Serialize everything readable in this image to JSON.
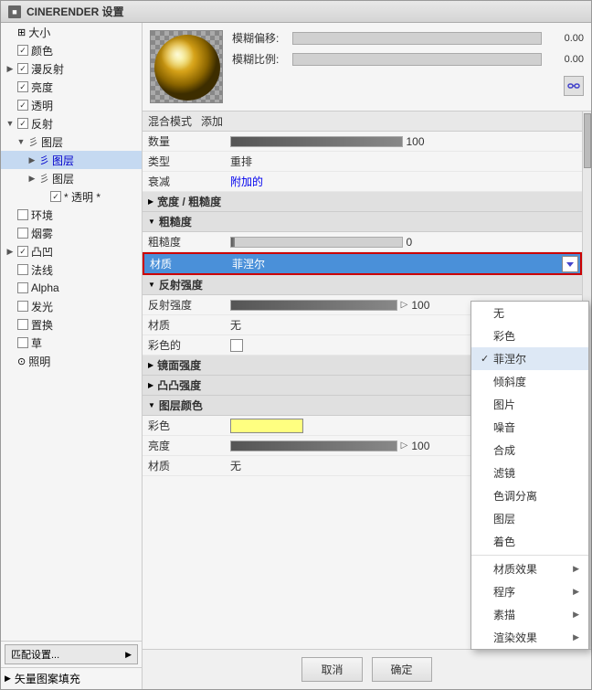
{
  "window": {
    "title": "CINERENDER 设置"
  },
  "sidebar": {
    "items": [
      {
        "id": "size",
        "label": "大小",
        "indent": 0,
        "hasCheckbox": false,
        "hasExpand": false,
        "iconType": "size"
      },
      {
        "id": "color",
        "label": "颜色",
        "indent": 0,
        "hasCheckbox": true,
        "checked": true,
        "hasExpand": false
      },
      {
        "id": "diffuse",
        "label": "漫反射",
        "indent": 0,
        "hasCheckbox": true,
        "checked": true,
        "hasExpand": true,
        "expanded": false
      },
      {
        "id": "brightness",
        "label": "亮度",
        "indent": 0,
        "hasCheckbox": true,
        "checked": true,
        "hasExpand": false
      },
      {
        "id": "transparency",
        "label": "透明",
        "indent": 0,
        "hasCheckbox": true,
        "checked": true,
        "hasExpand": false
      },
      {
        "id": "reflection",
        "label": "反射",
        "indent": 0,
        "hasCheckbox": true,
        "checked": true,
        "hasExpand": true,
        "expanded": true
      },
      {
        "id": "layers",
        "label": "图层",
        "indent": 1,
        "hasCheckbox": false,
        "hasExpand": true,
        "expanded": true,
        "iconType": "layers"
      },
      {
        "id": "layer1",
        "label": "图层",
        "indent": 2,
        "hasCheckbox": false,
        "hasExpand": true,
        "expanded": false,
        "iconType": "layers",
        "selected": false
      },
      {
        "id": "layer2",
        "label": "图层",
        "indent": 2,
        "hasCheckbox": false,
        "hasExpand": true,
        "expanded": false,
        "iconType": "layers"
      },
      {
        "id": "transparency_sub",
        "label": "* 透明 *",
        "indent": 3,
        "hasCheckbox": true,
        "checked": true,
        "hasExpand": false
      },
      {
        "id": "environment",
        "label": "环境",
        "indent": 0,
        "hasCheckbox": false,
        "hasExpand": false
      },
      {
        "id": "fog",
        "label": "烟雾",
        "indent": 0,
        "hasCheckbox": false,
        "hasExpand": false
      },
      {
        "id": "bump",
        "label": "凸凹",
        "indent": 0,
        "hasCheckbox": true,
        "checked": true,
        "hasExpand": true,
        "expanded": false
      },
      {
        "id": "normal",
        "label": "法线",
        "indent": 0,
        "hasCheckbox": false,
        "hasExpand": false
      },
      {
        "id": "alpha",
        "label": "Alpha",
        "indent": 0,
        "hasCheckbox": false,
        "hasExpand": false
      },
      {
        "id": "glow",
        "label": "发光",
        "indent": 0,
        "hasCheckbox": false,
        "hasExpand": false
      },
      {
        "id": "displacement",
        "label": "置换",
        "indent": 0,
        "hasCheckbox": false,
        "hasExpand": false
      },
      {
        "id": "grass",
        "label": "草",
        "indent": 0,
        "hasCheckbox": false,
        "hasExpand": false
      },
      {
        "id": "illumination",
        "label": "照明",
        "indent": 0,
        "hasCheckbox": false,
        "hasExpand": false,
        "iconType": "light"
      }
    ],
    "matchSettingsBtn": "匹配设置...",
    "vectorFill": "矢量图案填充"
  },
  "preview": {
    "blurOffset_label": "模糊偏移:",
    "blurOffset_value": "0.00",
    "blurScale_label": "模糊比例:",
    "blurScale_value": "0.00"
  },
  "props": {
    "blendMode_label": "混合模式",
    "blendMode_value": "添加",
    "count_label": "数量",
    "count_value": "100",
    "type_label": "类型",
    "type_value": "重排",
    "decay_label": "衰减",
    "decay_value": "附加的",
    "sections": {
      "roughnessWidth": "宽度 / 粗糙度",
      "roughness": "粗糙度",
      "roughness_label": "粗糙度",
      "roughness_value": "0",
      "material_label": "材质",
      "material_value": "菲涅尔",
      "reflectionStrength": "反射强度",
      "reflStrength_label": "反射强度",
      "reflStrength_value": "100",
      "reflMaterial_label": "材质",
      "reflMaterial_value": "无",
      "reflColor_label": "彩色的",
      "mirrorStrength": "镜面强度",
      "bumpStrength": "凸凸强度",
      "layerColor": "图层颜色",
      "layerColor_label": "彩色",
      "layerBrightness_label": "亮度",
      "layerBrightness_value": "100",
      "layerMaterial_label": "材质",
      "layerMaterial_value": "无"
    }
  },
  "dropdown": {
    "items": [
      {
        "id": "none",
        "label": "无",
        "checked": false,
        "hasSubmenu": false
      },
      {
        "id": "color",
        "label": "彩色",
        "checked": false,
        "hasSubmenu": false
      },
      {
        "id": "fresnel",
        "label": "菲涅尔",
        "checked": true,
        "hasSubmenu": false
      },
      {
        "id": "gradient",
        "label": "倾斜度",
        "checked": false,
        "hasSubmenu": false
      },
      {
        "id": "image",
        "label": "图片",
        "checked": false,
        "hasSubmenu": false
      },
      {
        "id": "noise",
        "label": "噪音",
        "checked": false,
        "hasSubmenu": false
      },
      {
        "id": "composite",
        "label": "合成",
        "checked": false,
        "hasSubmenu": false
      },
      {
        "id": "filter",
        "label": "滤镜",
        "checked": false,
        "hasSubmenu": false
      },
      {
        "id": "colorization",
        "label": "色调分离",
        "checked": false,
        "hasSubmenu": false
      },
      {
        "id": "layer_dd",
        "label": "图层",
        "checked": false,
        "hasSubmenu": false
      },
      {
        "id": "tinting",
        "label": "着色",
        "checked": false,
        "hasSubmenu": false
      },
      {
        "id": "divider1",
        "isDivider": true
      },
      {
        "id": "material_effect",
        "label": "材质效果",
        "checked": false,
        "hasSubmenu": true
      },
      {
        "id": "program",
        "label": "程序",
        "checked": false,
        "hasSubmenu": true
      },
      {
        "id": "sketch",
        "label": "素描",
        "checked": false,
        "hasSubmenu": true
      },
      {
        "id": "render_effect",
        "label": "渲染效果",
        "checked": false,
        "hasSubmenu": true
      }
    ]
  },
  "buttons": {
    "cancel": "取消",
    "ok": "确定"
  },
  "icons": {
    "expand_right": "▶",
    "expand_down": "▼",
    "check": "✓",
    "arrow_right": "▷",
    "layers_icon": "彡",
    "light_icon": "⊙"
  }
}
